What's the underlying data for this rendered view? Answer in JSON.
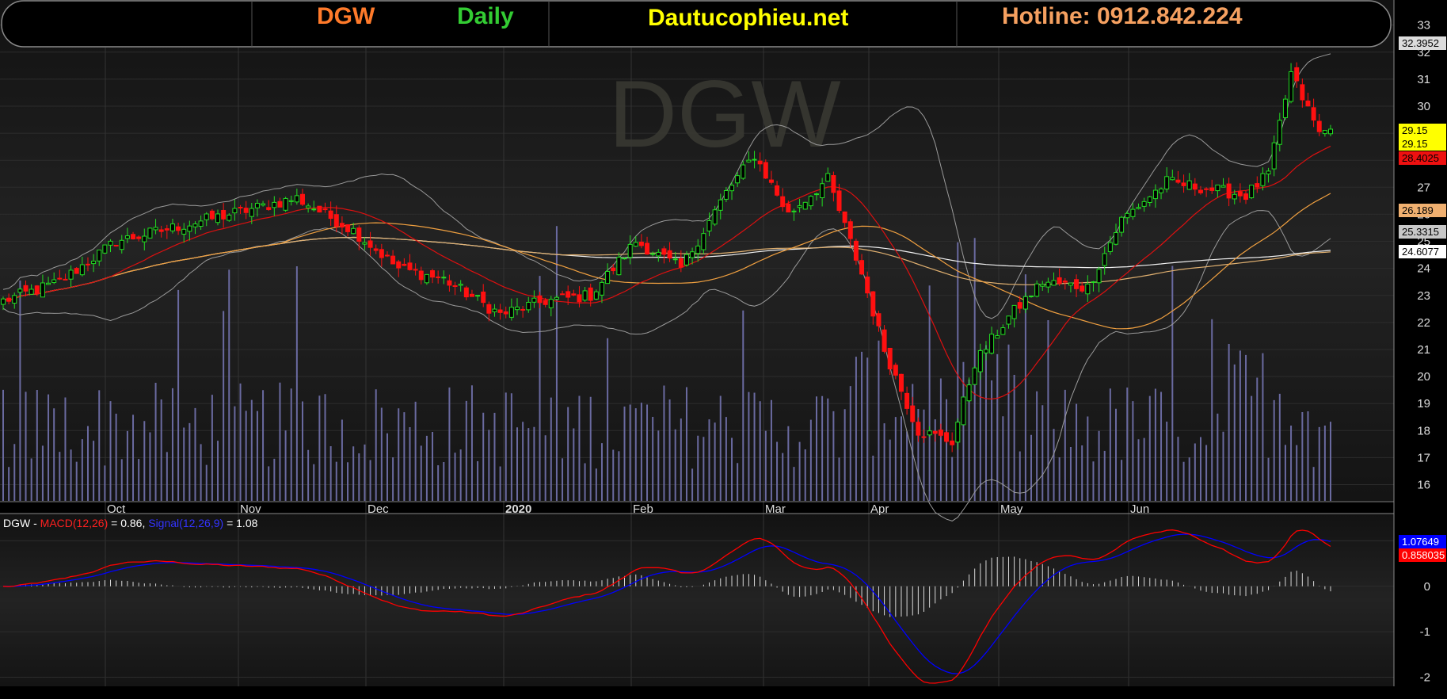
{
  "header": {
    "symbol": "DGW",
    "timeframe": "Daily",
    "site": "Dautucophieu.net",
    "hotline": "Hotline: 0912.842.224"
  },
  "watermark": "DGW",
  "colors": {
    "background": "#000000",
    "panel": "#1c1c1c",
    "up": "#22dd22",
    "down": "#ff1010",
    "symbol": "#ff7a2a",
    "timeframe": "#33cc33",
    "site": "#ffff00",
    "hotline": "#f5a060",
    "volume": "#6a6aa0",
    "macd": "#ff0000",
    "signal": "#0000ff"
  },
  "price_tags": {
    "bb_upper": "32.3952",
    "close": "29.15",
    "close_dup": "29.15",
    "ma20": "28.4025",
    "ma50": "26.189",
    "ma100": "25.3315",
    "ma200": "24.6077"
  },
  "macd_legend": {
    "prefix": "DGW - ",
    "macd": "MACD(12,26)",
    "macd_value": " = 0.86, ",
    "signal": "Signal(12,26,9)",
    "signal_value": " = 1.08"
  },
  "macd_tags": {
    "signal": "1.07649",
    "macd": "0.858035"
  },
  "chart_data": [
    {
      "type": "candlestick",
      "title": "DGW Daily",
      "x_labels": [
        "Oct",
        "Nov",
        "Dec",
        "2020",
        "Feb",
        "Mar",
        "Apr",
        "May",
        "Jun"
      ],
      "y_ticks": [
        16,
        17,
        18,
        19,
        20,
        21,
        22,
        23,
        24,
        25,
        26,
        27,
        28,
        29,
        30,
        31,
        32,
        33
      ],
      "ylim": [
        15.4,
        33.4
      ],
      "anchors": [
        {
          "t": 0,
          "price": 22.8
        },
        {
          "t": 10,
          "price": 23.5
        },
        {
          "t": 20,
          "price": 25.0
        },
        {
          "t": 30,
          "price": 25.5
        },
        {
          "t": 40,
          "price": 26.0
        },
        {
          "t": 52,
          "price": 26.6
        },
        {
          "t": 62,
          "price": 25.4
        },
        {
          "t": 70,
          "price": 24.0
        },
        {
          "t": 78,
          "price": 23.6
        },
        {
          "t": 88,
          "price": 22.3
        },
        {
          "t": 96,
          "price": 22.8
        },
        {
          "t": 104,
          "price": 23.0
        },
        {
          "t": 112,
          "price": 25.0
        },
        {
          "t": 120,
          "price": 24.0
        },
        {
          "t": 128,
          "price": 26.8
        },
        {
          "t": 133,
          "price": 28.2
        },
        {
          "t": 139,
          "price": 26.0
        },
        {
          "t": 146,
          "price": 27.3
        },
        {
          "t": 152,
          "price": 23.8
        },
        {
          "t": 156,
          "price": 21.0
        },
        {
          "t": 162,
          "price": 18.0
        },
        {
          "t": 168,
          "price": 17.6
        },
        {
          "t": 172,
          "price": 20.5
        },
        {
          "t": 178,
          "price": 22.2
        },
        {
          "t": 184,
          "price": 23.5
        },
        {
          "t": 192,
          "price": 23.3
        },
        {
          "t": 198,
          "price": 25.8
        },
        {
          "t": 206,
          "price": 27.2
        },
        {
          "t": 212,
          "price": 27.0
        },
        {
          "t": 220,
          "price": 26.7
        },
        {
          "t": 224,
          "price": 27.5
        },
        {
          "t": 228,
          "price": 31.2
        },
        {
          "t": 233,
          "price": 29.0
        },
        {
          "t": 235,
          "price": 29.15
        }
      ],
      "bars_count": 236,
      "last_close": 29.15,
      "bollinger_upper_last": 32.3952,
      "ma_last": {
        "ma20": 28.4025,
        "ma50": 26.189,
        "ma100": 25.3315,
        "ma200": 24.6077
      }
    },
    {
      "type": "line",
      "title": "MACD(12,26) / Signal(12,26,9)",
      "y_ticks": [
        -2,
        -1,
        0,
        1
      ],
      "ylim": [
        -2.2,
        1.6
      ],
      "series": [
        {
          "name": "MACD(12,26)",
          "last": 0.86
        },
        {
          "name": "Signal(12,26,9)",
          "last": 1.08
        }
      ]
    }
  ]
}
